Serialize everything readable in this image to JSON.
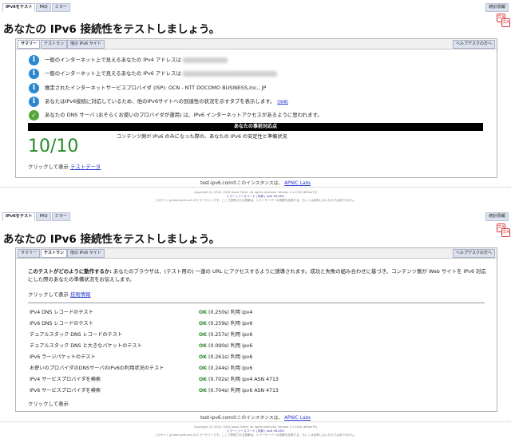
{
  "top_tabs": [
    {
      "label": "IPv6をテスト",
      "active": true
    },
    {
      "label": "FAQ",
      "active": false
    },
    {
      "label": "ミラー",
      "active": false
    }
  ],
  "stats_label": "統計情報",
  "lang_icon_text": "文A",
  "page_title": "あなたの IPv6 接続性をテストしましょう。",
  "sub_tabs": [
    {
      "label": "サマリー"
    },
    {
      "label": "テストラン"
    },
    {
      "label": "他の IPv6 サイト"
    }
  ],
  "help_label": "ヘルプデスクの方へ",
  "summary": {
    "rows": [
      {
        "icon": "info-icon",
        "text": "一般のインターネット上で見えるあなたの IPv4 アドレスは"
      },
      {
        "icon": "info-icon",
        "text": "一般のインターネット上で見えるあなたの IPv6 アドレスは"
      },
      {
        "icon": "info-icon",
        "text": "推定されたインターネットサービスプロバイダ (ISP): OCN - NTT DOCOMO BUSINESS,Inc., JP"
      },
      {
        "icon": "info-icon",
        "text": "あなたはIPv6接続に対応しているため、他のIPv6サイトへの到達性の状況を示すタブを表示します。",
        "link": "[詳細]"
      },
      {
        "icon": "check-icon",
        "text": "あなたの DNS サーバ (おそらくお使いのプロバイダが運用) は、IPv6 インターネットアクセスがあるように思われます。"
      }
    ],
    "banner": "あなたの事前対応点",
    "score": "10/10",
    "score_note": "コンテンツ側が IPv6 のみになった際の、あなたの IPv6 の安定性と準備状況",
    "show_prefix": "クリックして表示",
    "show_link": "テストデータ"
  },
  "tests": {
    "intro_bold": "このテストがどのように動作するか:",
    "intro": " あなたのブラウザは、(テスト用の) 一連の URL にアクセスするように誘導されます。成功と失敗の組み合わせに基づき、コンテンツ側が Web サイトを IPv6 対応にした際のあなたの準備状況をお伝えします。",
    "show_prefix": "クリックして表示",
    "show_link": "技術情報",
    "rows": [
      {
        "name": "IPv4 DNS レコードのテスト",
        "status": "OK",
        "detail": "(0.250s) 利用 ipv4"
      },
      {
        "name": "IPv6 DNS レコードのテスト",
        "status": "OK",
        "detail": "(0.259s) 利用 ipv6"
      },
      {
        "name": "デュアルスタック DNS レコードのテスト",
        "status": "OK",
        "detail": "(0.257s) 利用 ipv6"
      },
      {
        "name": "デュアルスタック DNS と大きなパケットのテスト",
        "status": "OK",
        "detail": "(0.090s) 利用 ipv6"
      },
      {
        "name": "IPv6 ラージパケットのテスト",
        "status": "OK",
        "detail": "(0.261s) 利用 ipv6"
      },
      {
        "name": "お使いのプロバイダのDNSサーバのIPv6の利用状況のテスト",
        "status": "OK",
        "detail": "(0.244s) 利用 ipv6"
      },
      {
        "name": "IPv4 サービスプロバイダを検索",
        "status": "OK",
        "detail": "(0.702s) 利用 ipv4 ASN 4713"
      },
      {
        "name": "IPv6 サービスプロバイダを検索",
        "status": "OK",
        "detail": "(0.704s) 利用 ipv6 ASN 4713"
      }
    ],
    "footer_show": "クリックして表示"
  },
  "footer": {
    "instance_prefix": "test-ipv6.comのこのインスタンスは、",
    "instance_link": "APNIC Labs",
    "copyright": "Copyright (C) 2010, 2024 Jason Fesler. All rights reserved. Version 1.1.1010 (8f3ae79)",
    "links": "ミラー | ソースコード | 特典 | ipv6 98.08%",
    "mirror_note": "このサイトは test-ipv6.com のミラーサイトです。ここで表明される見解は、ミラーサーバーの見解を反映する、もしくは反映しないものではありません。"
  }
}
